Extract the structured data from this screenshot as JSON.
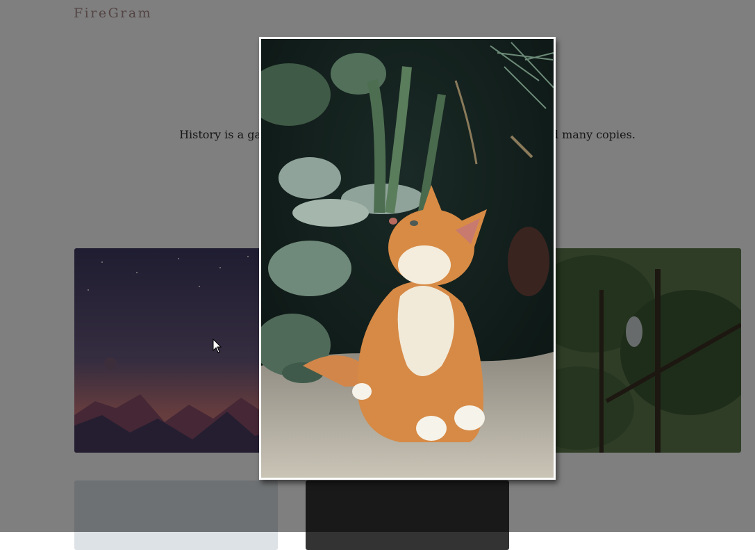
{
  "header": {
    "brand": "FireGram"
  },
  "hero": {
    "tagline": "History is a gallery of pictures in which there are few originals and many copies."
  },
  "gallery": {
    "images": [
      {
        "subject": "purple mountain dusk illustration"
      },
      {
        "subject": "orange kitten among plants"
      },
      {
        "subject": "green pine forest"
      },
      {
        "subject": "misty grey landscape"
      },
      {
        "subject": "dark textured photo"
      }
    ]
  },
  "modal": {
    "subject": "orange kitten looking up among green plants"
  },
  "colors": {
    "brand": "#a88a8a",
    "backdrop": "rgba(0,0,0,0.5)",
    "modal_border": "#ffffff"
  }
}
